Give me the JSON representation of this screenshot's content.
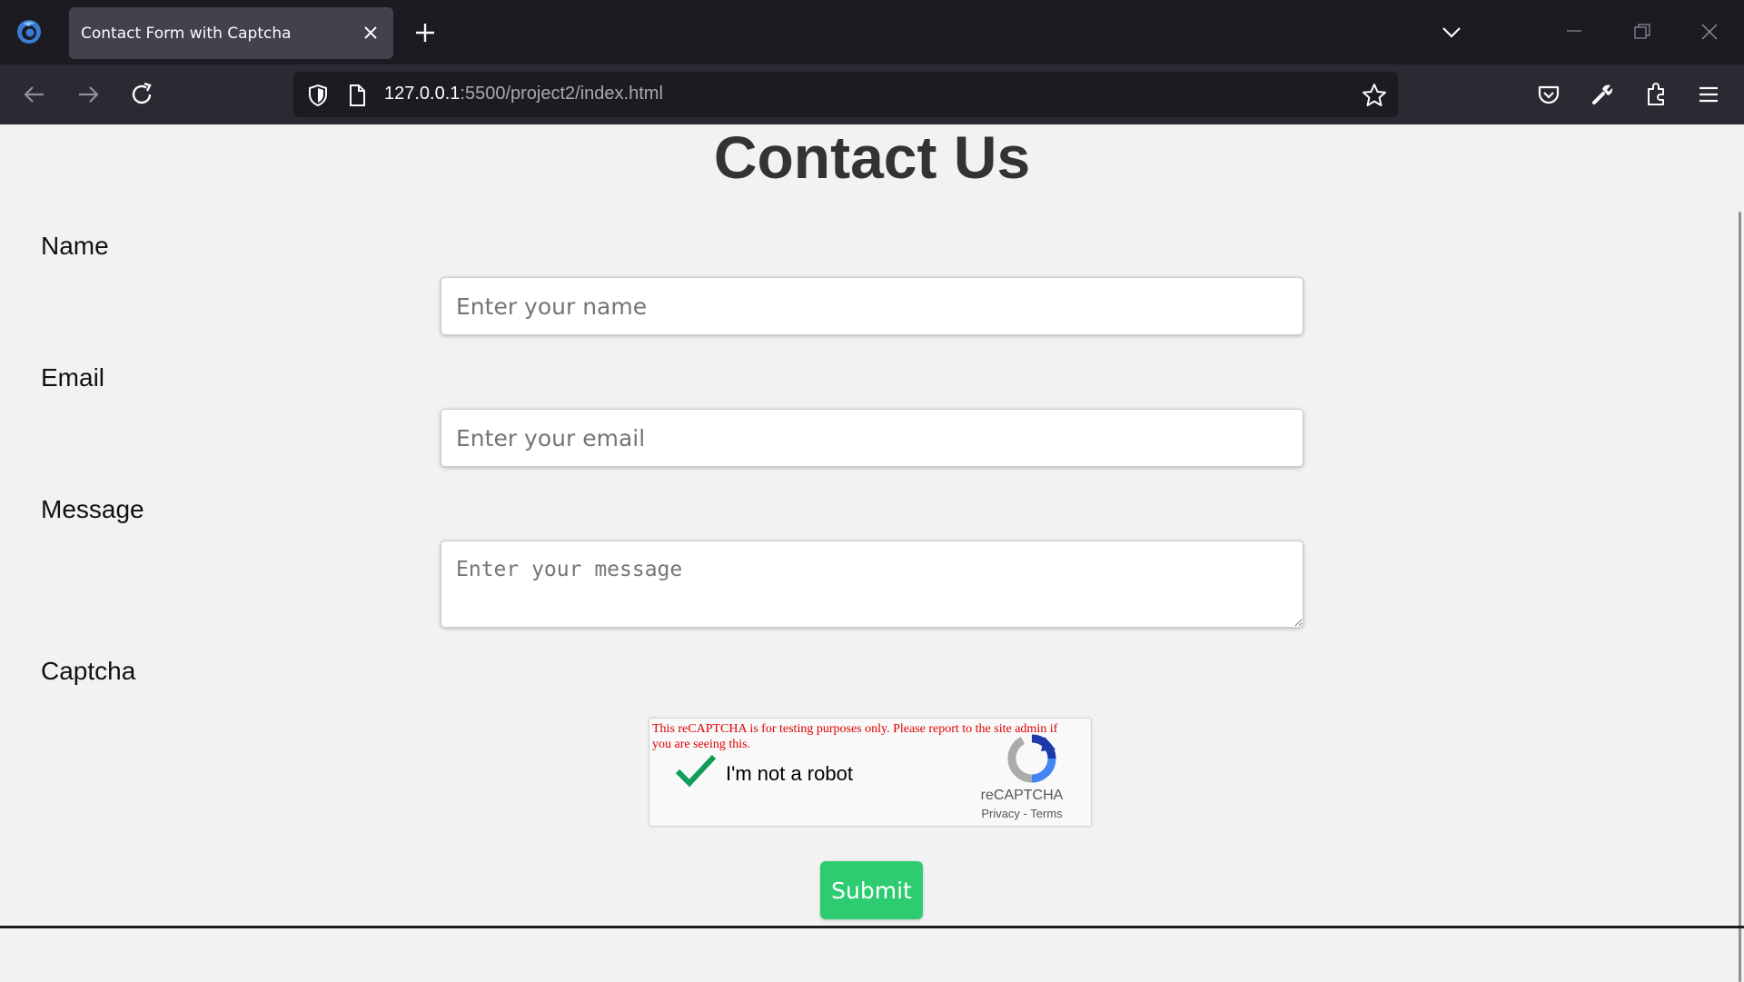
{
  "browser": {
    "tab_title": "Contact Form with Captcha",
    "url_host": "127.0.0.1",
    "url_rest": ":5500/project2/index.html"
  },
  "page": {
    "title": "Contact Us",
    "fields": {
      "name_label": "Name",
      "name_placeholder": "Enter your name",
      "email_label": "Email",
      "email_placeholder": "Enter your email",
      "message_label": "Message",
      "message_placeholder": "Enter your message",
      "captcha_label": "Captcha"
    },
    "recaptcha": {
      "warning": "This reCAPTCHA is for testing purposes only. Please report to the site admin if you are seeing this.",
      "checkbox_label": "I'm not a robot",
      "checked": true,
      "brand": "reCAPTCHA",
      "privacy": "Privacy",
      "separator": "-",
      "terms": "Terms"
    },
    "submit_label": "Submit"
  },
  "colors": {
    "page_bg": "#f2f2f2",
    "submit_bg": "#2ecc71",
    "check_green": "#0f9d58",
    "warning_red": "#e00000"
  }
}
